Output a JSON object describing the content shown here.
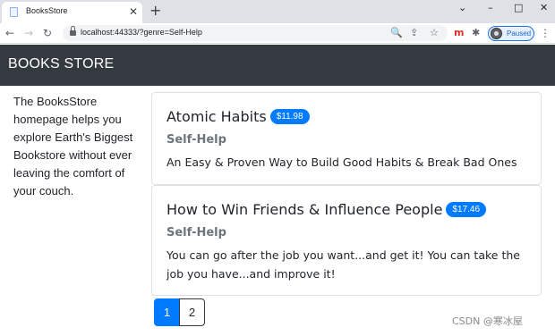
{
  "browser": {
    "tab_title": "BooksStore",
    "tab_close": "✕",
    "new_tab": "+",
    "window_controls": [
      "⌄",
      "–",
      "□",
      "✕"
    ],
    "nav": {
      "back": "←",
      "forward": "→",
      "reload": "↻"
    },
    "url": "localhost:44333/?genre=Self-Help",
    "omnibox_icons": [
      "🔍",
      "⇪",
      "☆"
    ],
    "extensions": [
      {
        "label": "m",
        "color": "#d93025"
      },
      {
        "label": "✱",
        "color": "#5f6368"
      }
    ],
    "profile_status": "Paused",
    "menu": "⋮"
  },
  "navbar": {
    "brand": "BOOKS STORE"
  },
  "sidebar": {
    "text": "The BooksStore homepage helps you explore Earth's Biggest Bookstore without ever leaving the comfort of your couch."
  },
  "books": [
    {
      "title": "Atomic Habits",
      "price": "$11.98",
      "genre": "Self-Help",
      "description": "An Easy & Proven Way to Build Good Habits & Break Bad Ones"
    },
    {
      "title": "How to Win Friends & Influence People",
      "price": "$17.46",
      "genre": "Self-Help",
      "description": "You can go after the job you want...and get it! You can take the job you have...and improve it!"
    }
  ],
  "pagination": {
    "pages": [
      "1",
      "2"
    ],
    "current": "1"
  },
  "watermark": "CSDN @寒冰屋",
  "colors": {
    "navbar": "#343a40",
    "accent": "#007bff",
    "muted": "#6c757d"
  }
}
